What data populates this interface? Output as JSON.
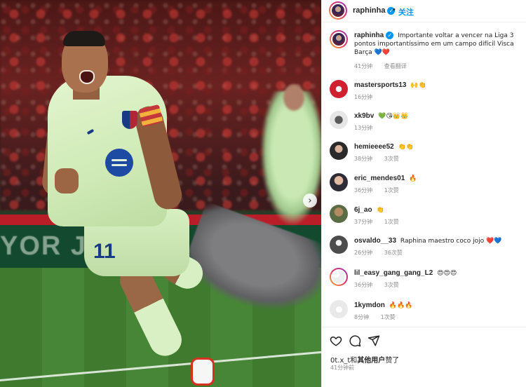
{
  "post": {
    "image_alt": "Raphinha celebrating a goal for FC Barcelona",
    "board_text": "YOR JU",
    "shirt_number": "11"
  },
  "header": {
    "username": "raphinha",
    "separator": "•",
    "follow_label": "关注"
  },
  "caption": {
    "username": "raphinha",
    "text": "Importante voltar a vencer na Liga 3 pontos importantíssimo em um campo difícil Visca Barça 💙❤️",
    "time": "41分钟",
    "translate": "查看翻译"
  },
  "comments": [
    {
      "username": "mastersports13",
      "text": "🙌👏",
      "time": "16分钟",
      "likes": ""
    },
    {
      "username": "xk9bv",
      "text": "💚😘👑👑",
      "time": "13分钟",
      "likes": ""
    },
    {
      "username": "hemieeee52",
      "text": "👏👏",
      "time": "38分钟",
      "likes": "3次赞"
    },
    {
      "username": "eric_mendes01",
      "text": "🔥",
      "time": "36分钟",
      "likes": "1次赞"
    },
    {
      "username": "6j_ao",
      "text": "👏",
      "time": "37分钟",
      "likes": "1次赞"
    },
    {
      "username": "osvaldo__33",
      "text": "Raphina maestro coco jojo ❤️💙",
      "time": "26分钟",
      "likes": "36次赞"
    },
    {
      "username": "lil_easy_gang_gang_L2",
      "text": "😍😍😍",
      "time": "36分钟",
      "likes": "3次赞"
    },
    {
      "username": "1kymdon",
      "text": "🔥🔥🔥",
      "time": "8分钟",
      "likes": "1次赞"
    }
  ],
  "actions": {
    "like_icon": "heart-icon",
    "comment_icon": "comment-icon",
    "share_icon": "share-icon",
    "liked_by_user": "0t.x_t和",
    "liked_by_others": "其他用户",
    "liked_suffix": "赞了",
    "time": "41分钟前"
  },
  "colors": {
    "accent": "#0095f6",
    "text": "#262626",
    "muted": "#8e8e8e",
    "border": "#efefef"
  }
}
